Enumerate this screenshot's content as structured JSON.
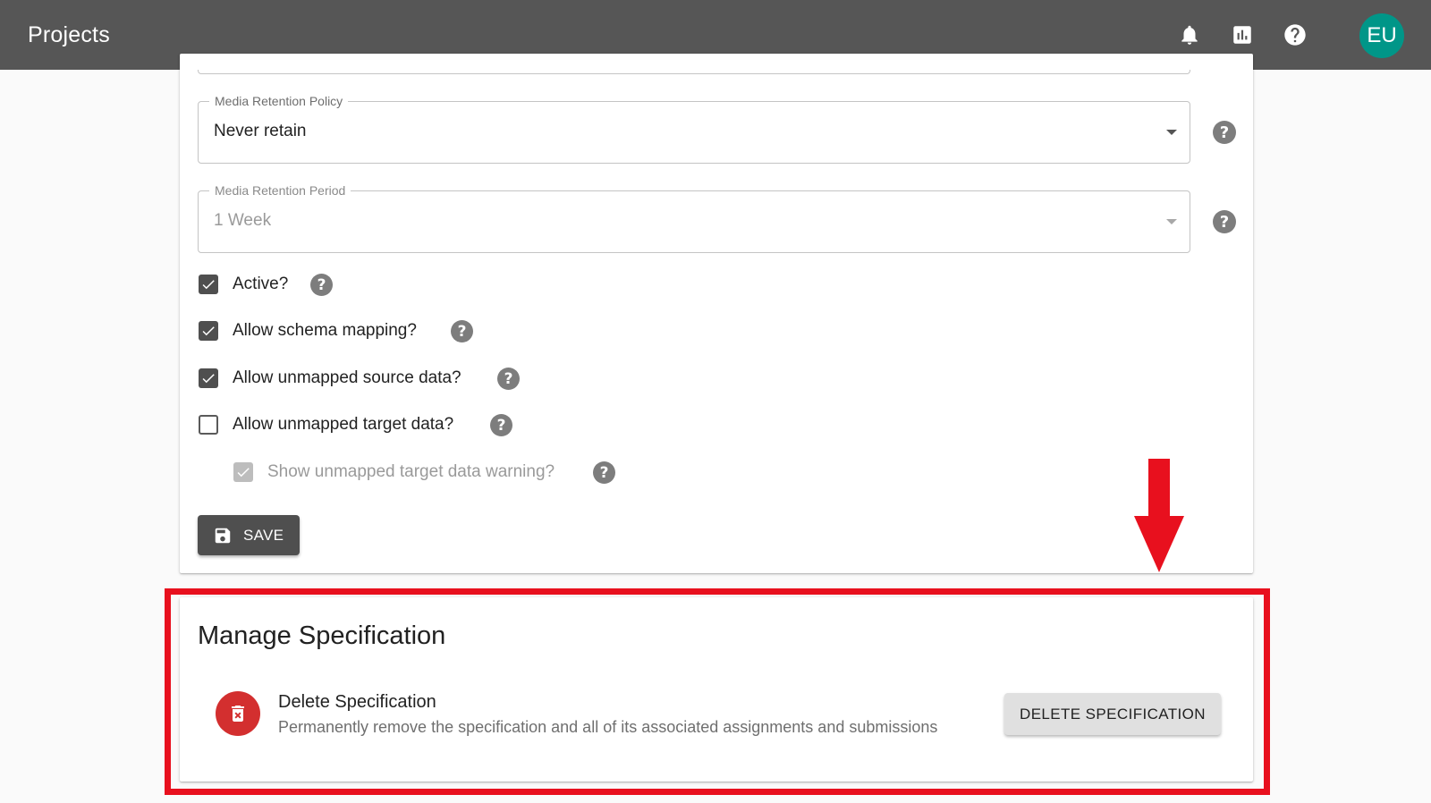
{
  "appbar": {
    "title": "Projects",
    "icons": [
      "bell-icon",
      "chart-icon",
      "help-icon"
    ],
    "avatar_initials": "EU",
    "avatar_color": "#009688"
  },
  "form": {
    "media_retention_policy": {
      "label": "Media Retention Policy",
      "value": "Never retain"
    },
    "media_retention_period": {
      "label": "Media Retention Period",
      "value": "1 Week",
      "disabled": true
    },
    "checkboxes": [
      {
        "label": "Active?",
        "checked": true
      },
      {
        "label": "Allow schema mapping?",
        "checked": true
      },
      {
        "label": "Allow unmapped source data?",
        "checked": true
      },
      {
        "label": "Allow unmapped target data?",
        "checked": false
      },
      {
        "label": "Show unmapped target data warning?",
        "checked": true,
        "disabled": true
      }
    ],
    "save_label": "SAVE"
  },
  "manage": {
    "title": "Manage Specification",
    "delete_title": "Delete Specification",
    "delete_description": "Permanently remove the specification and all of its associated assignments and submissions",
    "delete_button": "DELETE SPECIFICATION"
  },
  "annotation": {
    "color": "#e8101e"
  }
}
